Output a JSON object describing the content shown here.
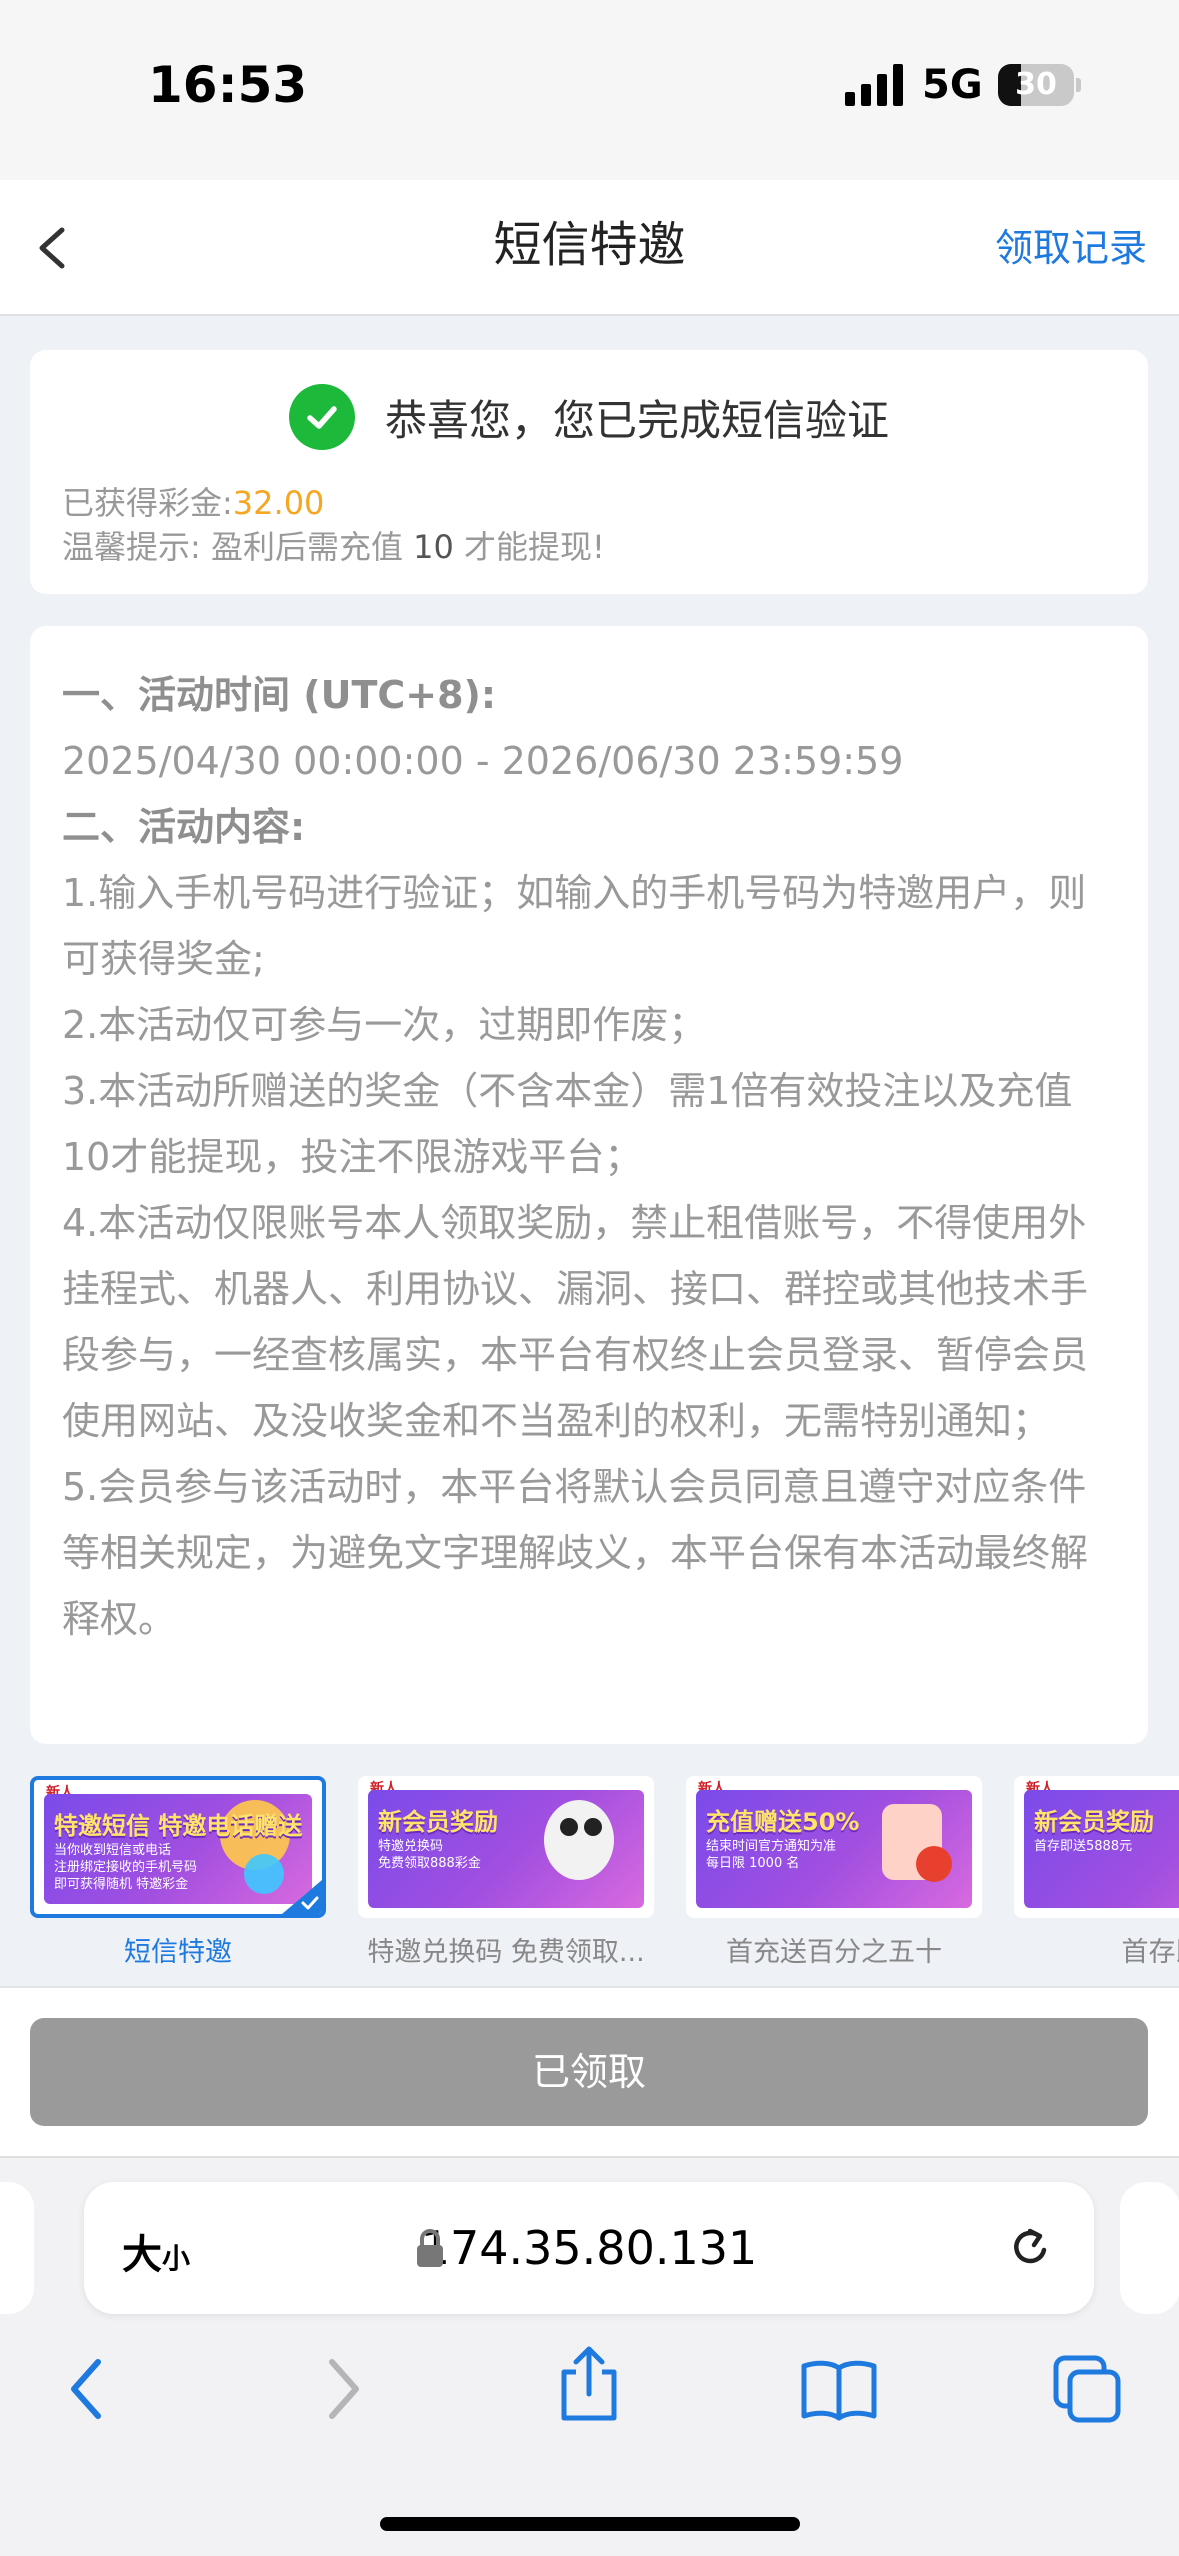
{
  "status": {
    "time": "16:53",
    "network": "5G",
    "battery": "30"
  },
  "nav": {
    "title": "短信特邀",
    "record": "领取记录",
    "back_icon": "chevron-left-icon"
  },
  "verify": {
    "message": "恭喜您，您已完成短信验证",
    "bonus_label": "已获得彩金:",
    "bonus_value": "32.00",
    "tip_prefix": "温馨提示: 盈利后需充值 ",
    "tip_amount": "10",
    "tip_suffix": " 才能提现!",
    "success_color": "#1cb93a",
    "bonus_color": "#f5a623"
  },
  "rules": [
    {
      "text": "一、活动时间 (UTC+8):",
      "head": true
    },
    {
      "text": "2025/04/30 00:00:00 - 2026/06/30 23:59:59",
      "head": false
    },
    {
      "text": "二、活动内容:",
      "head": true
    },
    {
      "text": "1.输入手机号码进行验证；如输入的手机号码为特邀用户，则可获得奖金;",
      "head": false
    },
    {
      "text": "2.本活动仅可参与一次，过期即作废；",
      "head": false
    },
    {
      "text": "3.本活动所赠送的奖金（不含本金）需1倍有效投注以及充值10才能提现，投注不限游戏平台；",
      "head": false
    },
    {
      "text": "4.本活动仅限账号本人领取奖励，禁止租借账号，不得使用外挂程式、机器人、利用协议、漏洞、接口、群控或其他技术手段参与，一经查核属实，本平台有权终止会员登录、暂停会员使用网站、及没收奖金和不当盈利的权利，无需特别通知；",
      "head": false
    },
    {
      "text": "5.会员参与该活动时，本平台将默认会员同意且遵守对应条件等相关规定，为避免文字理解歧义，本平台保有本活动最终解释权。",
      "head": false
    }
  ],
  "promos": [
    {
      "label": "短信特邀",
      "tag": "新人",
      "banner_title": "特邀短信 特邀电话赠送",
      "banner_sub": "当你收到短信或电话\n注册绑定接收的手机号码\n即可获得随机 特邀彩金",
      "selected": true
    },
    {
      "label": "特邀兑换码 免费领取...",
      "tag": "新人",
      "banner_title": "新会员奖励",
      "banner_sub": "特邀兑换码\n免费领取888彩金",
      "selected": false
    },
    {
      "label": "首充送百分之五十",
      "tag": "新人",
      "banner_title": "充值赠送50%",
      "banner_sub": "结束时间官方通知为准\n每日限 1000 名",
      "selected": false
    },
    {
      "label": "首存即",
      "tag": "新人",
      "banner_title": "新会员奖励",
      "banner_sub": "首存即送5888元",
      "selected": false
    }
  ],
  "claim_button": "已领取",
  "browser": {
    "aa_big": "大",
    "aa_small": "小",
    "url": "174.35.80.131",
    "toolbar_icons": [
      "back-icon",
      "forward-icon",
      "share-icon",
      "bookmarks-icon",
      "tabs-icon"
    ]
  }
}
